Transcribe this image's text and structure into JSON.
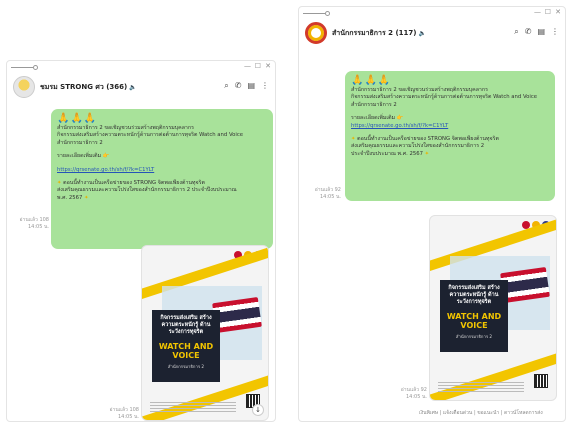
{
  "left": {
    "chat_name": "ชมรม STRONG ศว",
    "chat_count": "(366)",
    "emoji_row": "🙏🙏🙏",
    "line1": "สำนักกรรมาธิการ 2 ขอเชิญชวนร่วมสร้างพฤติกรรมบุคลากร",
    "line2": "กิจกรรมส่งเสริมสร้างความตระหนักรู้ด้านการต่อต้านการทุจริต Watch and Voice",
    "line3": "สำนักกรรมาธิการ 2",
    "detail_label": "รายละเอียดเพิ่มเติม",
    "link": "https://qrsenate.go.th/sh/f/?k=C1YLT",
    "note1": "ตอนนี้ทำงานเป็นเครือข่ายของ STRONG จิตพอเพียงต้านทุจริต",
    "note2": "ส่งเสริมคุณธรรมและความโปร่งใสของสำนักกรรมาธิการ 2 ประจำปีงบประมาณ",
    "note3": "พ.ศ. 2567",
    "ts1_a": "อ่านแล้ว 108",
    "ts1_b": "14:05 น.",
    "ts2_a": "อ่านแล้ว 108",
    "ts2_b": "14:05 น."
  },
  "right": {
    "chat_name": "สำนักกรรมาธิการ 2",
    "chat_count": "(117)",
    "emoji_row": "🙏🙏🙏",
    "line1": "สำนักกรรมาธิการ 2 ขอเชิญชวนร่วมสร้างพฤติกรรมบุคลากร",
    "line2": "กิจกรรมส่งเสริมสร้างความตระหนักรู้ด้านการต่อต้านการทุจริต Watch and Voice",
    "line3": "สำนักกรรมาธิการ 2",
    "detail_label": "รายละเอียดเพิ่มเติม",
    "link": "https://qrsenate.go.th/sh/f/?k=C1YLT",
    "note1": "ตอนนี้ทำงานเป็นเครือข่ายของ STRONG จิตพอเพียงต้านทุจริต",
    "note2": "ส่งเสริมคุณธรรมและความโปร่งใสของสำนักกรรมาธิการ 2",
    "note3": "ประจำปีงบประมาณ พ.ศ. 2567",
    "ts1_a": "อ่านแล้ว 92",
    "ts1_b": "14:05 น.",
    "ts2_a": "อ่านแล้ว 92",
    "ts2_b": "14:05 น.",
    "footer": "เงินพิเศษ | แจ้งเตือนด่วน | ขอแนะนำ | ดาวน์โหลดการส่ง"
  },
  "poster": {
    "title": "กิจกรรมส่งเสริม สร้างความตระหนักรู้ ด้านระวังการทุจริต",
    "headline": "WATCH AND VOICE",
    "org": "สำนักกรรมาธิการ 2"
  },
  "icons": {
    "search": "⌕",
    "call": "✆",
    "notes": "▤",
    "menu": "⋮",
    "minimize": "—",
    "maximize": "☐",
    "close": "✕",
    "download": "↓",
    "sound": "🔈"
  }
}
